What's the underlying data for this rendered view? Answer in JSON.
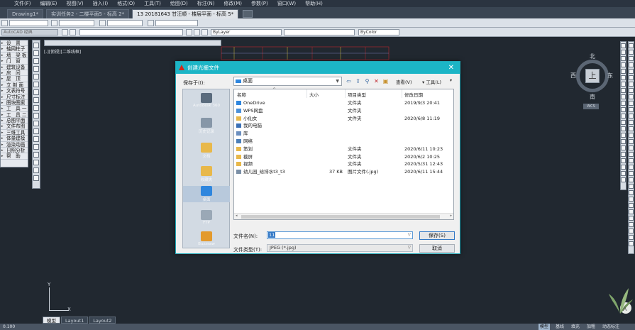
{
  "menu": [
    "文件(F)",
    "编辑(E)",
    "视图(V)",
    "插入(I)",
    "格式(O)",
    "工具(T)",
    "绘图(D)",
    "标注(N)",
    "修改(M)",
    "参数(P)",
    "窗口(W)",
    "帮助(H)"
  ],
  "doc_tabs": [
    "Drawing1*",
    "实训任务2 - 二楼平面5 - 标高 2*",
    "13  20181643  甘汪顺 - 楼层平面 - 标高 5*"
  ],
  "toolbar": {
    "workspace": "AutoCAD 经典",
    "layer_color": "ByLayer",
    "layer_color2": "ByColor"
  },
  "palette_items": [
    "设　置",
    "轴网柱子",
    "墙　梁 板",
    "门　窗",
    "建筑设备",
    "房　间",
    "屋　顶",
    "立 剖 面",
    "文表符号",
    "尺寸标注",
    "图块图案",
    "工　具 一",
    "工　具 二",
    "总图平面",
    "文件布图",
    "三维工具",
    "体量建模",
    "渲染动画",
    "日照分析",
    "帮　助"
  ],
  "view_label": "[-][俯视][二维线框]",
  "compass": {
    "n": "北",
    "s": "南",
    "e": "东",
    "w": "西",
    "top": "上",
    "wcs": "WCS"
  },
  "ucs": {
    "x": "X",
    "y": "Y"
  },
  "layout_tabs": [
    "模型",
    "Layout1",
    "Layout2"
  ],
  "status": {
    "left": "0.100",
    "right": [
      "模型",
      "基线",
      "填充",
      "加粗",
      "动态标注"
    ]
  },
  "dialog": {
    "title": "创建光栅文件",
    "save_in_label": "保存于(I):",
    "save_in_value": "桌面",
    "view_label": "查看(V)",
    "tools_label": "工具(L)",
    "places": [
      "Autodesk 360",
      "历史记录",
      "文档",
      "收藏夹",
      "桌面",
      "FTP",
      "Buzzsaw"
    ],
    "columns": [
      "名称",
      "大小",
      "项目类型",
      "修改日期"
    ],
    "files": [
      {
        "name": "OneDrive",
        "size": "",
        "type": "文件夹",
        "date": "2019/9/3 20:41",
        "icon": "cloud"
      },
      {
        "name": "WPS网盘",
        "size": "",
        "type": "文件夹",
        "date": "",
        "icon": "cloud2"
      },
      {
        "name": "小仙女",
        "size": "",
        "type": "文件夹",
        "date": "2020/6/8 11:19",
        "icon": "user"
      },
      {
        "name": "我的电脑",
        "size": "",
        "type": "",
        "date": "",
        "icon": "pc"
      },
      {
        "name": "库",
        "size": "",
        "type": "",
        "date": "",
        "icon": "lib"
      },
      {
        "name": "网络",
        "size": "",
        "type": "",
        "date": "",
        "icon": "net"
      },
      {
        "name": "策划",
        "size": "",
        "type": "文件夹",
        "date": "2020/6/11 10:23",
        "icon": "folder"
      },
      {
        "name": "截屏",
        "size": "",
        "type": "文件夹",
        "date": "2020/6/2 10:25",
        "icon": "folder"
      },
      {
        "name": "视频",
        "size": "",
        "type": "文件夹",
        "date": "2020/5/31 12:43",
        "icon": "folder"
      },
      {
        "name": "幼儿园_给排水t3_t3",
        "size": "37 KB",
        "type": "图片文件(.jpg)",
        "date": "2020/6/11 15:44",
        "icon": "img"
      }
    ],
    "filename_label": "文件名(N):",
    "filename_value": "11",
    "filetype_label": "文件类型(T):",
    "filetype_value": "JPEG (*.jpg)",
    "save_button": "保存(S)",
    "cancel_button": "取消"
  },
  "colors": {
    "accent": "#1cb5c6",
    "canvas": "#212830",
    "folder": "#e8b84a"
  }
}
